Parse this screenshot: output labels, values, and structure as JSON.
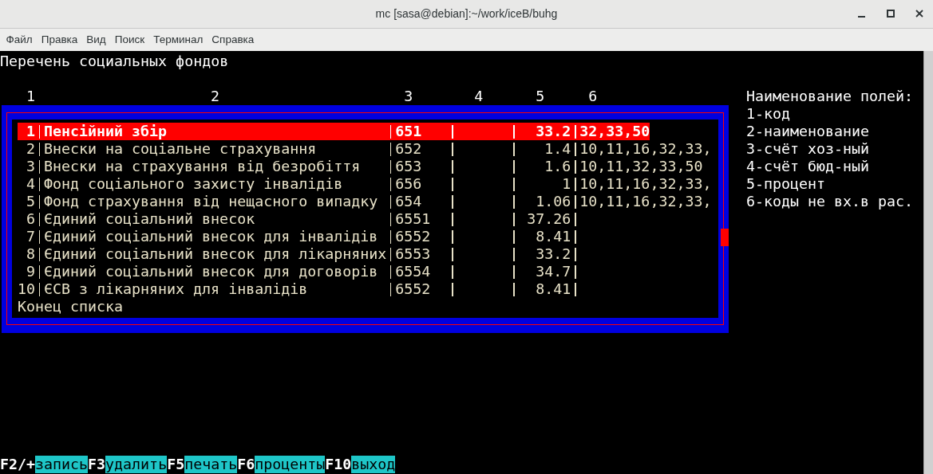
{
  "window": {
    "title": "mc [sasa@debian]:~/work/iceB/buhg"
  },
  "menu": [
    "Файл",
    "Правка",
    "Вид",
    "Поиск",
    "Терминал",
    "Справка"
  ],
  "screen_title": "Перечень социальных фондов",
  "columns": [
    "1",
    "2",
    "3",
    "4",
    "5",
    "6"
  ],
  "rows": [
    {
      "num": "1",
      "name": "Пенсійний збір",
      "acct_hoz": "651",
      "percent": "33.2",
      "codes": "32,33,50",
      "selected": true
    },
    {
      "num": "2",
      "name": "Внески на соціальне страхування",
      "acct_hoz": "652",
      "percent": "1.4",
      "codes": "10,11,16,32,33,",
      "selected": false
    },
    {
      "num": "3",
      "name": "Внески на страхування від безробіття",
      "acct_hoz": "653",
      "percent": "1.6",
      "codes": "10,11,32,33,50",
      "selected": false
    },
    {
      "num": "4",
      "name": "Фонд соціального захисту інвалідів",
      "acct_hoz": "656",
      "percent": "1",
      "codes": "10,11,16,32,33,",
      "selected": false
    },
    {
      "num": "5",
      "name": "Фонд страхування від нещасного випадку",
      "acct_hoz": "654",
      "percent": "1.06",
      "codes": "10,11,16,32,33,",
      "selected": false
    },
    {
      "num": "6",
      "name": "Єдиний соціальний внесок",
      "acct_hoz": "6551",
      "percent": "37.26",
      "selected": false
    },
    {
      "num": "7",
      "name": "Єдиний соціальний внесок для інвалідів",
      "acct_hoz": "6552",
      "percent": "8.41",
      "selected": false
    },
    {
      "num": "8",
      "name": "Єдиний соціальний внесок для лікарняних",
      "acct_hoz": "6553",
      "percent": "33.2",
      "selected": false
    },
    {
      "num": "9",
      "name": "Єдиний соціальний внесок для договорів",
      "acct_hoz": "6554",
      "percent": "34.7",
      "selected": false
    },
    {
      "num": "10",
      "name": "ЄСВ з лікарняних для інвалідів",
      "acct_hoz": "6552",
      "percent": "8.41",
      "selected": false
    }
  ],
  "end_label": "Конец списка",
  "legend": {
    "title": "Наименование полей:",
    "items": [
      "1-код",
      "2-наименование",
      "3-счёт хоз-ный",
      "4-счёт бюд-ный",
      "5-процент",
      "6-коды не вх.в рас."
    ]
  },
  "function_keys": [
    {
      "key": "F2/+",
      "label": "запись"
    },
    {
      "key": "F3",
      "label": "удалить"
    },
    {
      "key": "F5",
      "label": "печать"
    },
    {
      "key": "F6",
      "label": "проценты"
    },
    {
      "key": "F10",
      "label": "выход"
    }
  ]
}
